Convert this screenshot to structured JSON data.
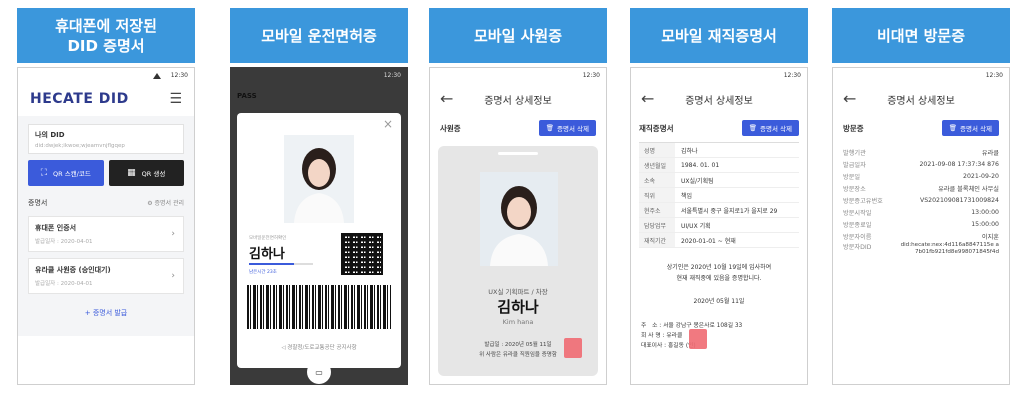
{
  "status_time": "12:30",
  "panels": [
    {
      "banner": "휴대폰에 저장된\nDID 증명서"
    },
    {
      "banner": "모바일 운전면허증"
    },
    {
      "banner": "모바일 사원증"
    },
    {
      "banner": "모바일 재직증명서"
    },
    {
      "banner": "비대면 방문증"
    }
  ],
  "p1": {
    "logo": "HECATE DID",
    "did_title": "나의 DID",
    "did_value": "did:dwjek;ikwoe;wjeamvnjflgqep",
    "qr_scan": "QR 스캔/코드",
    "qr_create": "QR 생성",
    "cert_section": "증명서",
    "cert_manage": "증명서 관리",
    "certs": [
      {
        "name": "휴대폰 인증서",
        "date": "발급일자 : 2020-04-01"
      },
      {
        "name": "유라클 사원증 (승인대기)",
        "date": "발급일자 : 2020-04-01"
      }
    ],
    "issue": "+ 증명서 발급"
  },
  "p2": {
    "pass": "PASS",
    "issuer": "경찰청/도로교통공단 공지사항",
    "small": "모바일운전면허확인",
    "name": "김하나",
    "remain": "남은시간 23초",
    "footer": "경찰청/도로교통공단 공지사항"
  },
  "p3": {
    "header": "증명서 상세정보",
    "type": "사원증",
    "delete": "증명서 삭제",
    "dept": "UX실 기획파트 / 차장",
    "name": "김하나",
    "eng": "Kim hana",
    "issued": "발급일 : 2020년 05월 11일",
    "note": "위 사람은 유라클 직원임을 증명함"
  },
  "p4": {
    "header": "증명서 상세정보",
    "type": "재직증명서",
    "delete": "증명서 삭제",
    "rows": [
      {
        "k": "성명",
        "v": "김하나"
      },
      {
        "k": "생년월일",
        "v": "1984. 01. 01"
      },
      {
        "k": "소속",
        "v": "UX실/기획팀"
      },
      {
        "k": "직위",
        "v": "책임"
      },
      {
        "k": "현주소",
        "v": "서울특별시 중구 을지로1가 을지로 29"
      },
      {
        "k": "담당업무",
        "v": "UI/UX 기획"
      },
      {
        "k": "재직기간",
        "v": "2020-01-01 ~ 현재"
      }
    ],
    "statement1": "상기인은 2020년 10월 19일에 입사하여",
    "statement2": "현재 재직중에 있음을 증명합니다.",
    "date": "2020년 05월 11일",
    "addr": "주　소 : 서울 강남구 봉은사로 108길 33",
    "company": "회 사 명 : 유라클",
    "ceo": "대표이사 : 홍길동 (인)"
  },
  "p5": {
    "header": "증명서 상세정보",
    "type": "방문증",
    "delete": "증명서 삭제",
    "rows": [
      {
        "k": "발행기관",
        "v": "유라클"
      },
      {
        "k": "발급일자",
        "v": "2021-09-08 17:37:34 876"
      },
      {
        "k": "방문일",
        "v": "2021-09-20"
      },
      {
        "k": "방문장소",
        "v": "유라클 블록체인 사무실"
      },
      {
        "k": "방문증고유번호",
        "v": "VS202109081731009824"
      },
      {
        "k": "방문시작일",
        "v": "13:00:00"
      },
      {
        "k": "방문종료일",
        "v": "15:00:00"
      },
      {
        "k": "방문자이름",
        "v": "이지훈"
      },
      {
        "k": "방문자DID",
        "v": "did:hecate:nex:4d116a8847115e a7b01fb921fd8e998071845f4d"
      }
    ]
  }
}
